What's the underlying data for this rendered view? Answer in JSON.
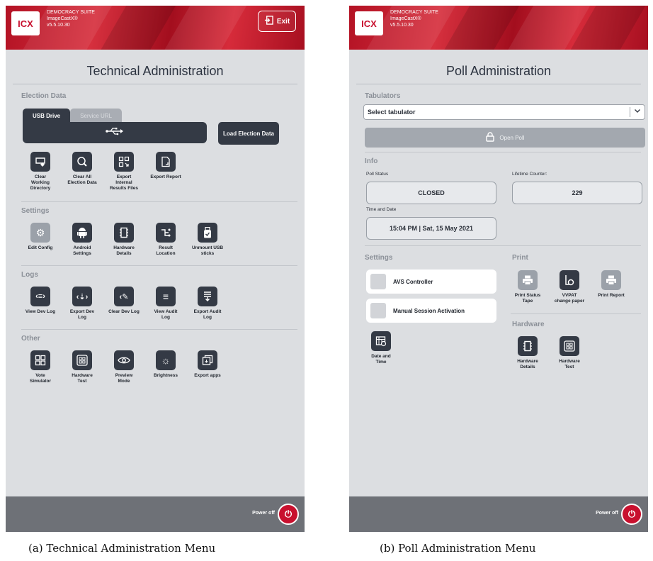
{
  "common": {
    "brand_line1": "DEMOCRACY SUITE",
    "brand_line2": "ImageCastX®",
    "brand_line3": "v5.5.10.30",
    "logo_text": "ICX",
    "power_off_label": "Power off"
  },
  "tech": {
    "exit_label": "Exit",
    "title": "Technical Administration",
    "election_data": {
      "heading": "Election Data",
      "tab_usb": "USB Drive",
      "tab_service": "Service URL",
      "load_button": "Load Election Data",
      "tiles": [
        "Clear\nWorking\nDirectory",
        "Clear All\nElection Data",
        "Export\nInternal\nResults Files",
        "Export Report"
      ]
    },
    "settings": {
      "heading": "Settings",
      "tiles": [
        "Edit Config",
        "Android\nSettings",
        "Hardware\nDetails",
        "Result\nLocation",
        "Unmount USB\nsticks"
      ]
    },
    "logs": {
      "heading": "Logs",
      "tiles": [
        "View Dev Log",
        "Export Dev\nLog",
        "Clear Dev Log",
        "View Audit\nLog",
        "Export Audit\nLog"
      ]
    },
    "other": {
      "heading": "Other",
      "tiles": [
        "Vote\nSimulator",
        "Hardware\nTest",
        "Preview\nMode",
        "Brightness",
        "Export apps"
      ]
    }
  },
  "poll": {
    "title": "Poll Administration",
    "tabulators_heading": "Tabulators",
    "select_tabulator": "Select tabulator",
    "open_poll": "Open Poll",
    "info_heading": "Info",
    "poll_status_label": "Poll Status",
    "poll_status_value": "CLOSED",
    "lifetime_counter_label": "Lifetime Counter:",
    "lifetime_counter_value": "229",
    "time_date_label": "Time and Date",
    "time_date_value": "15:04 PM | Sat, 15 May 2021",
    "settings_heading": "Settings",
    "avs_controller": "AVS Controller",
    "manual_session": "Manual Session Activation",
    "date_time_tile": "Date and\nTime",
    "print_heading": "Print",
    "print_tiles": [
      "Print Status\nTape",
      "VVPAT\nchange paper",
      "Print Report"
    ],
    "hardware_heading": "Hardware",
    "hardware_tiles": [
      "Hardware\nDetails",
      "Hardware\nTest"
    ]
  },
  "captions": {
    "a": "(a) Technical Administration Menu",
    "b": "(b) Poll Administration Menu"
  },
  "colors": {
    "brand_red": "#c8102e",
    "tile_dark": "#343a45",
    "screen_bg": "#dcdee1",
    "bottom_bar": "#6e7177"
  },
  "icons": {
    "usb": "usb-icon",
    "exit": "exit-icon",
    "power": "power-icon",
    "lock": "lock-icon",
    "chevron": "chevron-down-icon"
  }
}
